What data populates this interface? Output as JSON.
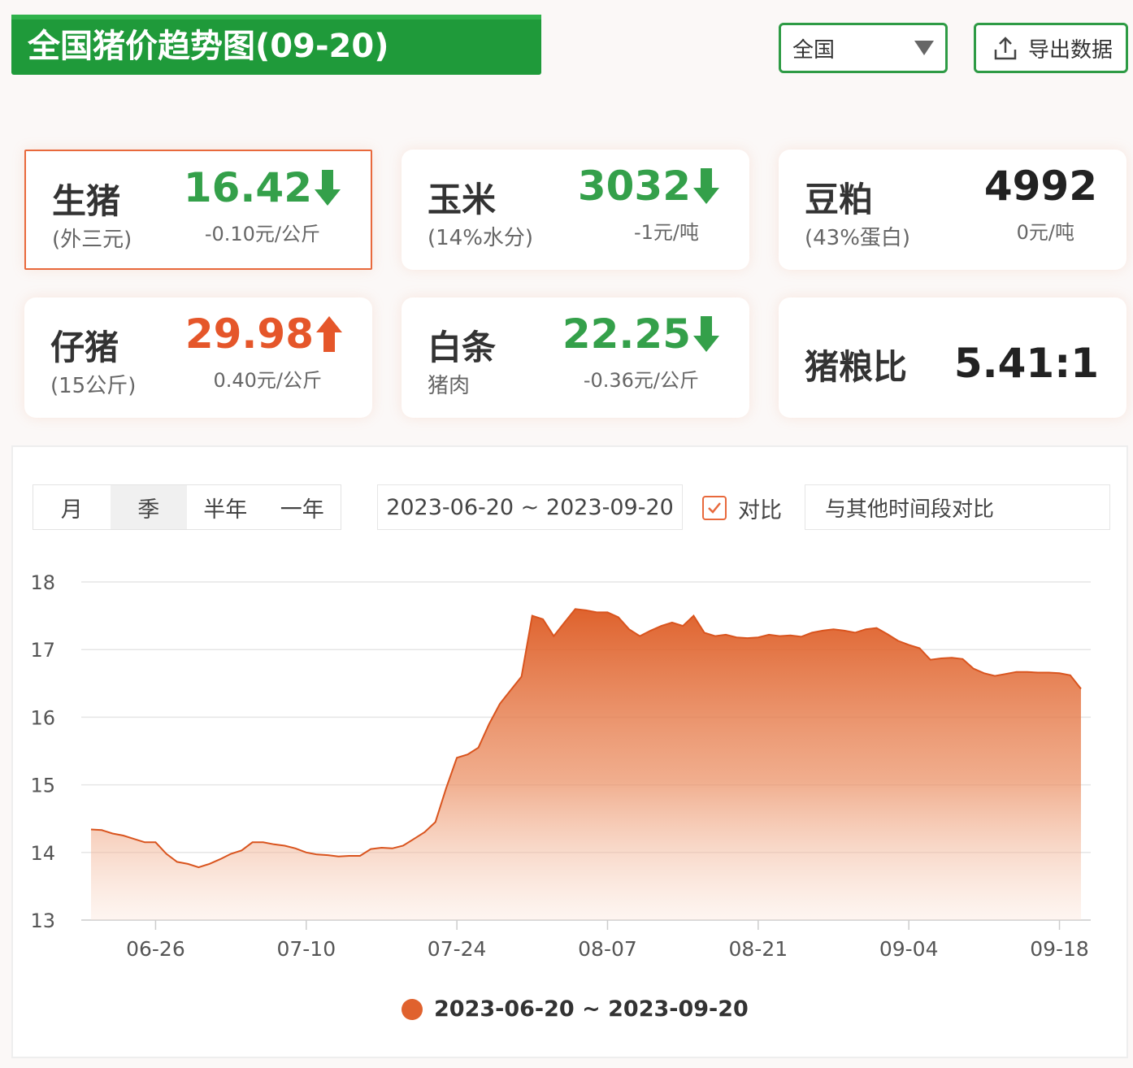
{
  "header": {
    "title": "全国猪价趋势图(09-20)",
    "region_select": "全国",
    "export_label": "导出数据"
  },
  "cards": [
    {
      "name": "生猪",
      "sub": "(外三元)",
      "value": "16.42",
      "change": "-0.10元/公斤",
      "direction": "down"
    },
    {
      "name": "玉米",
      "sub": "(14%水分)",
      "value": "3032",
      "change": "-1元/吨",
      "direction": "down"
    },
    {
      "name": "豆粕",
      "sub": "(43%蛋白)",
      "value": "4992",
      "change": "0元/吨",
      "direction": "flat"
    },
    {
      "name": "仔猪",
      "sub": "(15公斤)",
      "value": "29.98",
      "change": "0.40元/公斤",
      "direction": "up"
    },
    {
      "name": "白条",
      "sub": "猪肉",
      "value": "22.25",
      "change": "-0.36元/公斤",
      "direction": "down"
    },
    {
      "name": "猪粮比",
      "sub": "",
      "value": "5.41:1",
      "change": "",
      "direction": "flat"
    }
  ],
  "period_tabs": [
    "月",
    "季",
    "半年",
    "一年"
  ],
  "selected_tab": "季",
  "date_range": "2023-06-20 ~ 2023-09-20",
  "compare": {
    "label": "对比",
    "checked": true,
    "placeholder": "与其他时间段对比"
  },
  "colors": {
    "green": "#34a04a",
    "red": "#e5562a",
    "accent": "#e0622e",
    "banner": "#1f9a3a"
  },
  "chart_data": {
    "type": "area",
    "ylim": [
      13,
      18
    ],
    "yticks": [
      "18",
      "17",
      "16",
      "15",
      "14",
      "13"
    ],
    "xtick_labels": [
      "06-26",
      "07-10",
      "07-24",
      "08-07",
      "08-21",
      "09-04",
      "09-18"
    ],
    "series": [
      {
        "name": "2023-06-20 ~ 2023-09-20",
        "x": [
          "06-20",
          "06-21",
          "06-22",
          "06-23",
          "06-24",
          "06-25",
          "06-26",
          "06-27",
          "06-28",
          "06-29",
          "06-30",
          "07-01",
          "07-02",
          "07-03",
          "07-04",
          "07-05",
          "07-06",
          "07-07",
          "07-08",
          "07-09",
          "07-10",
          "07-11",
          "07-12",
          "07-13",
          "07-14",
          "07-15",
          "07-16",
          "07-17",
          "07-18",
          "07-19",
          "07-20",
          "07-21",
          "07-22",
          "07-23",
          "07-24",
          "07-25",
          "07-26",
          "07-27",
          "07-28",
          "07-29",
          "07-30",
          "07-31",
          "08-01",
          "08-02",
          "08-03",
          "08-04",
          "08-05",
          "08-06",
          "08-07",
          "08-08",
          "08-09",
          "08-10",
          "08-11",
          "08-12",
          "08-13",
          "08-14",
          "08-15",
          "08-16",
          "08-17",
          "08-18",
          "08-19",
          "08-20",
          "08-21",
          "08-22",
          "08-23",
          "08-24",
          "08-25",
          "08-26",
          "08-27",
          "08-28",
          "08-29",
          "08-30",
          "08-31",
          "09-01",
          "09-02",
          "09-03",
          "09-04",
          "09-05",
          "09-06",
          "09-07",
          "09-08",
          "09-09",
          "09-10",
          "09-11",
          "09-12",
          "09-13",
          "09-14",
          "09-15",
          "09-16",
          "09-17",
          "09-18",
          "09-19",
          "09-20"
        ],
        "values": [
          14.34,
          14.33,
          14.28,
          14.25,
          14.2,
          14.15,
          14.15,
          13.98,
          13.86,
          13.83,
          13.78,
          13.83,
          13.9,
          13.98,
          14.03,
          14.15,
          14.15,
          14.12,
          14.1,
          14.06,
          14.0,
          13.97,
          13.96,
          13.94,
          13.95,
          13.95,
          14.05,
          14.07,
          14.06,
          14.1,
          14.2,
          14.3,
          14.45,
          14.95,
          15.4,
          15.45,
          15.55,
          15.9,
          16.2,
          16.4,
          16.6,
          17.5,
          17.45,
          17.2,
          17.4,
          17.6,
          17.58,
          17.55,
          17.55,
          17.48,
          17.3,
          17.2,
          17.28,
          17.35,
          17.4,
          17.35,
          17.5,
          17.25,
          17.2,
          17.22,
          17.18,
          17.17,
          17.18,
          17.22,
          17.2,
          17.21,
          17.19,
          17.25,
          17.28,
          17.3,
          17.28,
          17.25,
          17.3,
          17.32,
          17.23,
          17.13,
          17.07,
          17.02,
          16.85,
          16.87,
          16.88,
          16.86,
          16.72,
          16.65,
          16.61,
          16.64,
          16.67,
          16.67,
          16.66,
          16.66,
          16.65,
          16.62,
          16.42
        ]
      }
    ]
  }
}
